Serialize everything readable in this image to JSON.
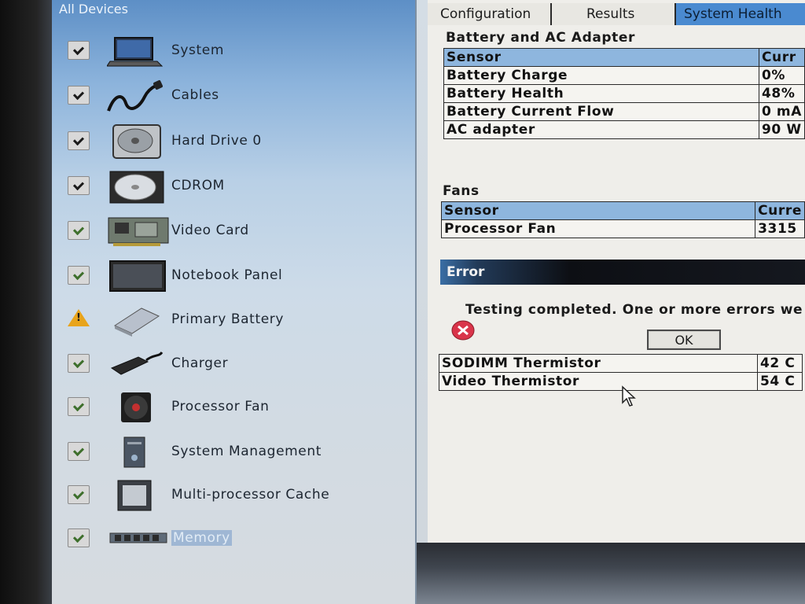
{
  "left_panel": {
    "title": "All Devices",
    "devices": [
      {
        "label": "System",
        "status": "passed",
        "icon": "laptop-icon"
      },
      {
        "label": "Cables",
        "status": "passed",
        "icon": "cable-icon"
      },
      {
        "label": "Hard Drive 0",
        "status": "passed",
        "icon": "hard-drive-icon"
      },
      {
        "label": "CDROM",
        "status": "passed",
        "icon": "cdrom-icon"
      },
      {
        "label": "Video Card",
        "status": "passed",
        "icon": "video-card-icon"
      },
      {
        "label": "Notebook Panel",
        "status": "passed",
        "icon": "notebook-panel-icon"
      },
      {
        "label": "Primary Battery",
        "status": "warning",
        "icon": "battery-icon"
      },
      {
        "label": "Charger",
        "status": "passed",
        "icon": "charger-icon"
      },
      {
        "label": "Processor Fan",
        "status": "passed",
        "icon": "fan-icon"
      },
      {
        "label": "System Management",
        "status": "passed",
        "icon": "system-management-icon"
      },
      {
        "label": "Multi-processor Cache",
        "status": "passed",
        "icon": "cpu-cache-icon"
      },
      {
        "label": "Memory",
        "status": "passed",
        "icon": "memory-icon"
      }
    ]
  },
  "tabs": [
    {
      "label": "Configuration",
      "active": false
    },
    {
      "label": "Results",
      "active": false
    },
    {
      "label": "System Health",
      "active": true
    }
  ],
  "battery_section": {
    "title": "Battery and AC Adapter",
    "header": [
      "Sensor",
      "Curr"
    ],
    "rows": [
      [
        "Battery Charge",
        "0%"
      ],
      [
        "Battery Health",
        "48%"
      ],
      [
        "Battery Current Flow",
        "0 mA"
      ],
      [
        "AC adapter",
        "90 W"
      ]
    ]
  },
  "fans_section": {
    "title": "Fans",
    "header": [
      "Sensor",
      "Curre"
    ],
    "rows": [
      [
        "Processor Fan",
        "3315"
      ]
    ]
  },
  "error_dialog": {
    "title": "Error",
    "message": "Testing completed. One or more errors we",
    "ok_label": "OK"
  },
  "thermal_rows": [
    [
      "SODIMM Thermistor",
      "42 C"
    ],
    [
      "Video Thermistor",
      "54 C"
    ]
  ],
  "colors": {
    "active_tab": "#4a8ad0",
    "table_header": "#8eb6de",
    "warning": "#e8a41c",
    "error_icon": "#d9344a"
  }
}
